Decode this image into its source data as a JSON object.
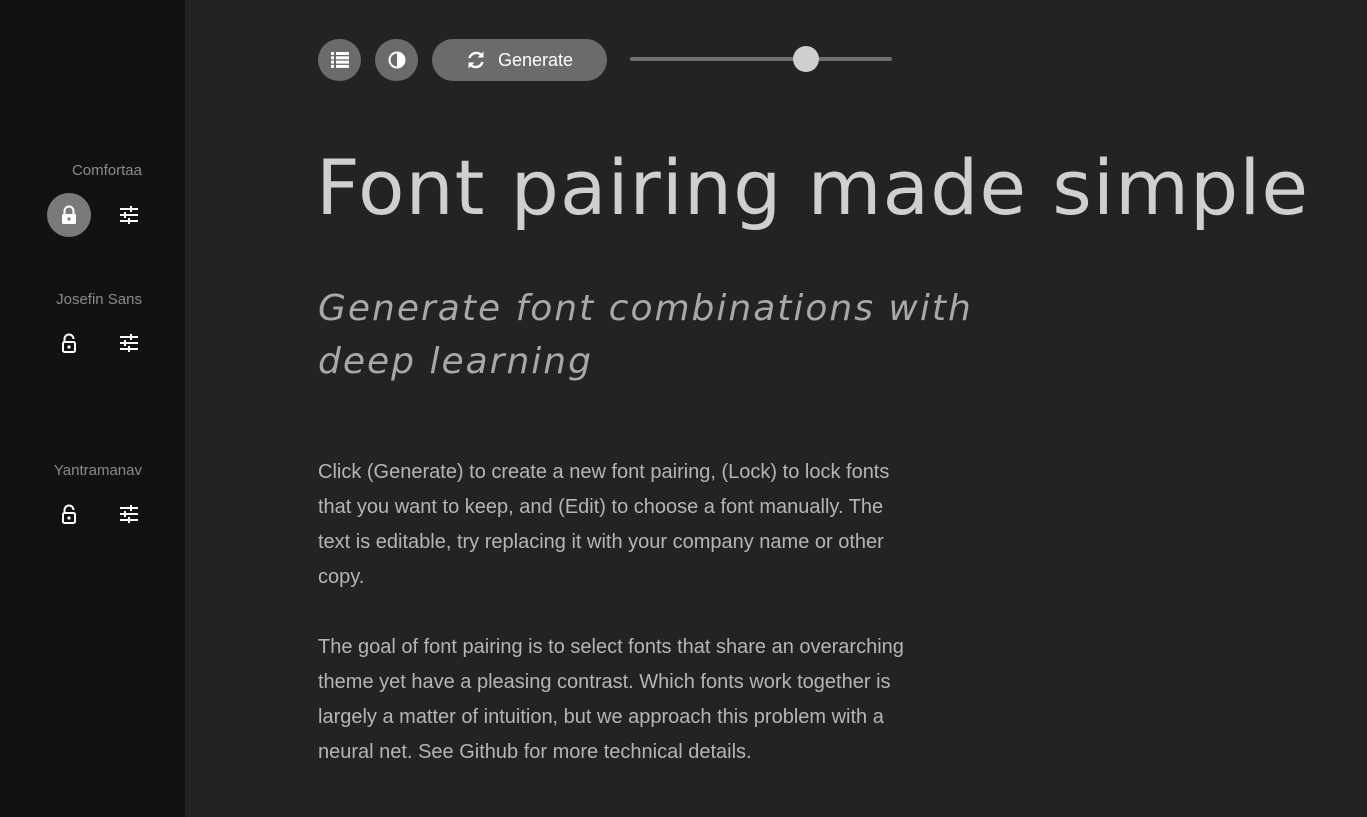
{
  "sidebar": {
    "fonts": [
      {
        "name": "Comfortaa",
        "locked": true
      },
      {
        "name": "Josefin Sans",
        "locked": false
      },
      {
        "name": "Yantramanav",
        "locked": false
      }
    ]
  },
  "toolbar": {
    "generate_label": "Generate",
    "slider_value": 0.67
  },
  "content": {
    "heading": "Font pairing made simple",
    "subheading": "Generate font combinations with deep learning",
    "paragraph1": "Click (Generate) to create a new font pairing, (Lock) to lock fonts that you want to keep, and (Edit) to choose a font manually. The text is editable, try replacing it with your company name or other copy.",
    "paragraph2": "The goal of font pairing is to select fonts that share an overarching theme yet have a pleasing contrast. Which fonts work together is largely a matter of intuition, but we approach this problem with a neural net. See Github for more technical details."
  },
  "colors": {
    "background": "#232323",
    "sidebar": "#121212",
    "button": "#6b6b6b",
    "heading": "#cfcfcf",
    "body_text": "#b5b5b5"
  },
  "icons": [
    "lock-icon",
    "unlock-icon",
    "tune-icon",
    "list-icon",
    "contrast-icon",
    "refresh-icon"
  ]
}
